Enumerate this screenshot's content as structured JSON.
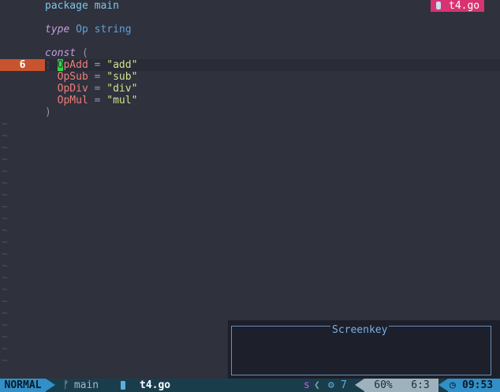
{
  "buffer": {
    "current_line_number": "6",
    "line1_kw": "package",
    "line1_name": "main",
    "line3_kw": "type",
    "line3_name": "Op",
    "line3_type": "string",
    "line5_kw": "const",
    "line5_paren": "(",
    "consts": [
      {
        "first": "O",
        "rest": "pAdd",
        "eq": "=",
        "val": "\"add\""
      },
      {
        "name": "OpSub",
        "eq": "=",
        "val": "\"sub\""
      },
      {
        "name": "OpDiv",
        "eq": "=",
        "val": "\"div\""
      },
      {
        "name": "OpMul",
        "eq": "=",
        "val": "\"mul\""
      }
    ],
    "close_paren": ")",
    "tilde": "~"
  },
  "tab": {
    "filename": "t4.go",
    "icon": "file-icon"
  },
  "screenkey": {
    "title": "Screenkey"
  },
  "statusbar": {
    "mode": "NORMAL",
    "branch_icon": "ᚠ",
    "branch": "main",
    "filename": "t4.go",
    "s_label": "s",
    "sep": "❮",
    "gear_icon": "⚙",
    "diag_count": "7",
    "percent": "60%",
    "position": "6:3",
    "clock_icon": "◷",
    "time": "09:53"
  },
  "colors": {
    "background": "#2f313d",
    "current_line_gutter": "#c8542f",
    "mode_bg": "#3190c8",
    "tab_badge": "#d63370",
    "cursor": "#33d64a"
  }
}
